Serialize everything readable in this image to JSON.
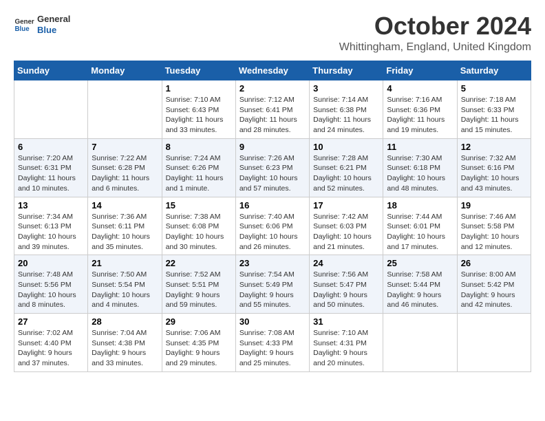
{
  "logo": {
    "line1": "General",
    "line2": "Blue"
  },
  "title": "October 2024",
  "location": "Whittingham, England, United Kingdom",
  "weekdays": [
    "Sunday",
    "Monday",
    "Tuesday",
    "Wednesday",
    "Thursday",
    "Friday",
    "Saturday"
  ],
  "weeks": [
    [
      {
        "day": "",
        "info": ""
      },
      {
        "day": "",
        "info": ""
      },
      {
        "day": "1",
        "info": "Sunrise: 7:10 AM\nSunset: 6:43 PM\nDaylight: 11 hours\nand 33 minutes."
      },
      {
        "day": "2",
        "info": "Sunrise: 7:12 AM\nSunset: 6:41 PM\nDaylight: 11 hours\nand 28 minutes."
      },
      {
        "day": "3",
        "info": "Sunrise: 7:14 AM\nSunset: 6:38 PM\nDaylight: 11 hours\nand 24 minutes."
      },
      {
        "day": "4",
        "info": "Sunrise: 7:16 AM\nSunset: 6:36 PM\nDaylight: 11 hours\nand 19 minutes."
      },
      {
        "day": "5",
        "info": "Sunrise: 7:18 AM\nSunset: 6:33 PM\nDaylight: 11 hours\nand 15 minutes."
      }
    ],
    [
      {
        "day": "6",
        "info": "Sunrise: 7:20 AM\nSunset: 6:31 PM\nDaylight: 11 hours\nand 10 minutes."
      },
      {
        "day": "7",
        "info": "Sunrise: 7:22 AM\nSunset: 6:28 PM\nDaylight: 11 hours\nand 6 minutes."
      },
      {
        "day": "8",
        "info": "Sunrise: 7:24 AM\nSunset: 6:26 PM\nDaylight: 11 hours\nand 1 minute."
      },
      {
        "day": "9",
        "info": "Sunrise: 7:26 AM\nSunset: 6:23 PM\nDaylight: 10 hours\nand 57 minutes."
      },
      {
        "day": "10",
        "info": "Sunrise: 7:28 AM\nSunset: 6:21 PM\nDaylight: 10 hours\nand 52 minutes."
      },
      {
        "day": "11",
        "info": "Sunrise: 7:30 AM\nSunset: 6:18 PM\nDaylight: 10 hours\nand 48 minutes."
      },
      {
        "day": "12",
        "info": "Sunrise: 7:32 AM\nSunset: 6:16 PM\nDaylight: 10 hours\nand 43 minutes."
      }
    ],
    [
      {
        "day": "13",
        "info": "Sunrise: 7:34 AM\nSunset: 6:13 PM\nDaylight: 10 hours\nand 39 minutes."
      },
      {
        "day": "14",
        "info": "Sunrise: 7:36 AM\nSunset: 6:11 PM\nDaylight: 10 hours\nand 35 minutes."
      },
      {
        "day": "15",
        "info": "Sunrise: 7:38 AM\nSunset: 6:08 PM\nDaylight: 10 hours\nand 30 minutes."
      },
      {
        "day": "16",
        "info": "Sunrise: 7:40 AM\nSunset: 6:06 PM\nDaylight: 10 hours\nand 26 minutes."
      },
      {
        "day": "17",
        "info": "Sunrise: 7:42 AM\nSunset: 6:03 PM\nDaylight: 10 hours\nand 21 minutes."
      },
      {
        "day": "18",
        "info": "Sunrise: 7:44 AM\nSunset: 6:01 PM\nDaylight: 10 hours\nand 17 minutes."
      },
      {
        "day": "19",
        "info": "Sunrise: 7:46 AM\nSunset: 5:58 PM\nDaylight: 10 hours\nand 12 minutes."
      }
    ],
    [
      {
        "day": "20",
        "info": "Sunrise: 7:48 AM\nSunset: 5:56 PM\nDaylight: 10 hours\nand 8 minutes."
      },
      {
        "day": "21",
        "info": "Sunrise: 7:50 AM\nSunset: 5:54 PM\nDaylight: 10 hours\nand 4 minutes."
      },
      {
        "day": "22",
        "info": "Sunrise: 7:52 AM\nSunset: 5:51 PM\nDaylight: 9 hours\nand 59 minutes."
      },
      {
        "day": "23",
        "info": "Sunrise: 7:54 AM\nSunset: 5:49 PM\nDaylight: 9 hours\nand 55 minutes."
      },
      {
        "day": "24",
        "info": "Sunrise: 7:56 AM\nSunset: 5:47 PM\nDaylight: 9 hours\nand 50 minutes."
      },
      {
        "day": "25",
        "info": "Sunrise: 7:58 AM\nSunset: 5:44 PM\nDaylight: 9 hours\nand 46 minutes."
      },
      {
        "day": "26",
        "info": "Sunrise: 8:00 AM\nSunset: 5:42 PM\nDaylight: 9 hours\nand 42 minutes."
      }
    ],
    [
      {
        "day": "27",
        "info": "Sunrise: 7:02 AM\nSunset: 4:40 PM\nDaylight: 9 hours\nand 37 minutes."
      },
      {
        "day": "28",
        "info": "Sunrise: 7:04 AM\nSunset: 4:38 PM\nDaylight: 9 hours\nand 33 minutes."
      },
      {
        "day": "29",
        "info": "Sunrise: 7:06 AM\nSunset: 4:35 PM\nDaylight: 9 hours\nand 29 minutes."
      },
      {
        "day": "30",
        "info": "Sunrise: 7:08 AM\nSunset: 4:33 PM\nDaylight: 9 hours\nand 25 minutes."
      },
      {
        "day": "31",
        "info": "Sunrise: 7:10 AM\nSunset: 4:31 PM\nDaylight: 9 hours\nand 20 minutes."
      },
      {
        "day": "",
        "info": ""
      },
      {
        "day": "",
        "info": ""
      }
    ]
  ]
}
